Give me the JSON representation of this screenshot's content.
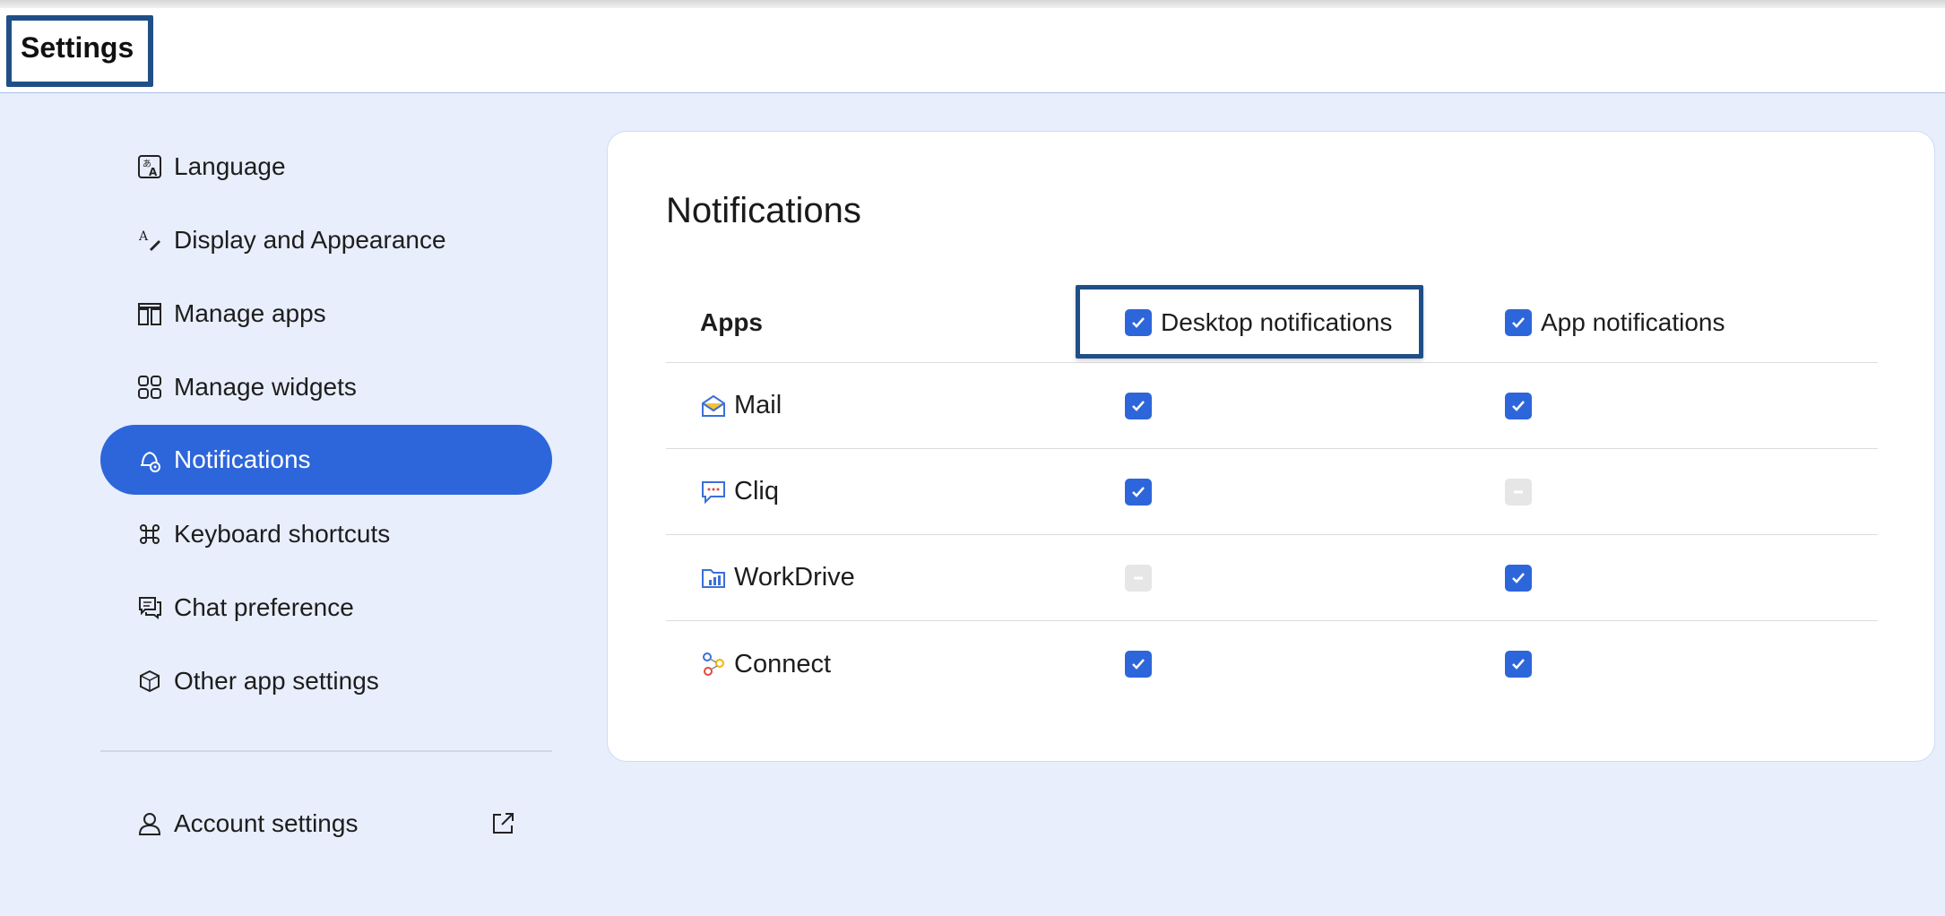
{
  "header": {
    "title": "Settings"
  },
  "sidebar": {
    "items": [
      {
        "label": "Language",
        "icon": "language-icon"
      },
      {
        "label": "Display and Appearance",
        "icon": "display-appearance-icon"
      },
      {
        "label": "Manage apps",
        "icon": "manage-apps-icon"
      },
      {
        "label": "Manage widgets",
        "icon": "widgets-icon"
      },
      {
        "label": "Notifications",
        "icon": "notification-bell-icon",
        "active": true
      },
      {
        "label": "Keyboard shortcuts",
        "icon": "command-key-icon"
      },
      {
        "label": "Chat preference",
        "icon": "chat-icon"
      },
      {
        "label": "Other app settings",
        "icon": "cube-icon"
      }
    ],
    "account": {
      "label": "Account settings",
      "icon": "user-icon",
      "external_icon": "external-link-icon"
    }
  },
  "notifications": {
    "title": "Notifications",
    "columns": {
      "apps": "Apps",
      "desktop": "Desktop notifications",
      "app": "App notifications"
    },
    "rows": [
      {
        "name": "Mail",
        "icon": "mail-icon",
        "desktop": "checked",
        "app": "checked"
      },
      {
        "name": "Cliq",
        "icon": "cliq-icon",
        "desktop": "checked",
        "app": "indeterminate-disabled"
      },
      {
        "name": "WorkDrive",
        "icon": "workdrive-icon",
        "desktop": "indeterminate-disabled",
        "app": "checked"
      },
      {
        "name": "Connect",
        "icon": "connect-icon",
        "desktop": "checked",
        "app": "checked"
      }
    ]
  },
  "colors": {
    "accent": "#2d66da",
    "page_background": "#e8eefb",
    "highlight_border": "#1f4f86"
  }
}
